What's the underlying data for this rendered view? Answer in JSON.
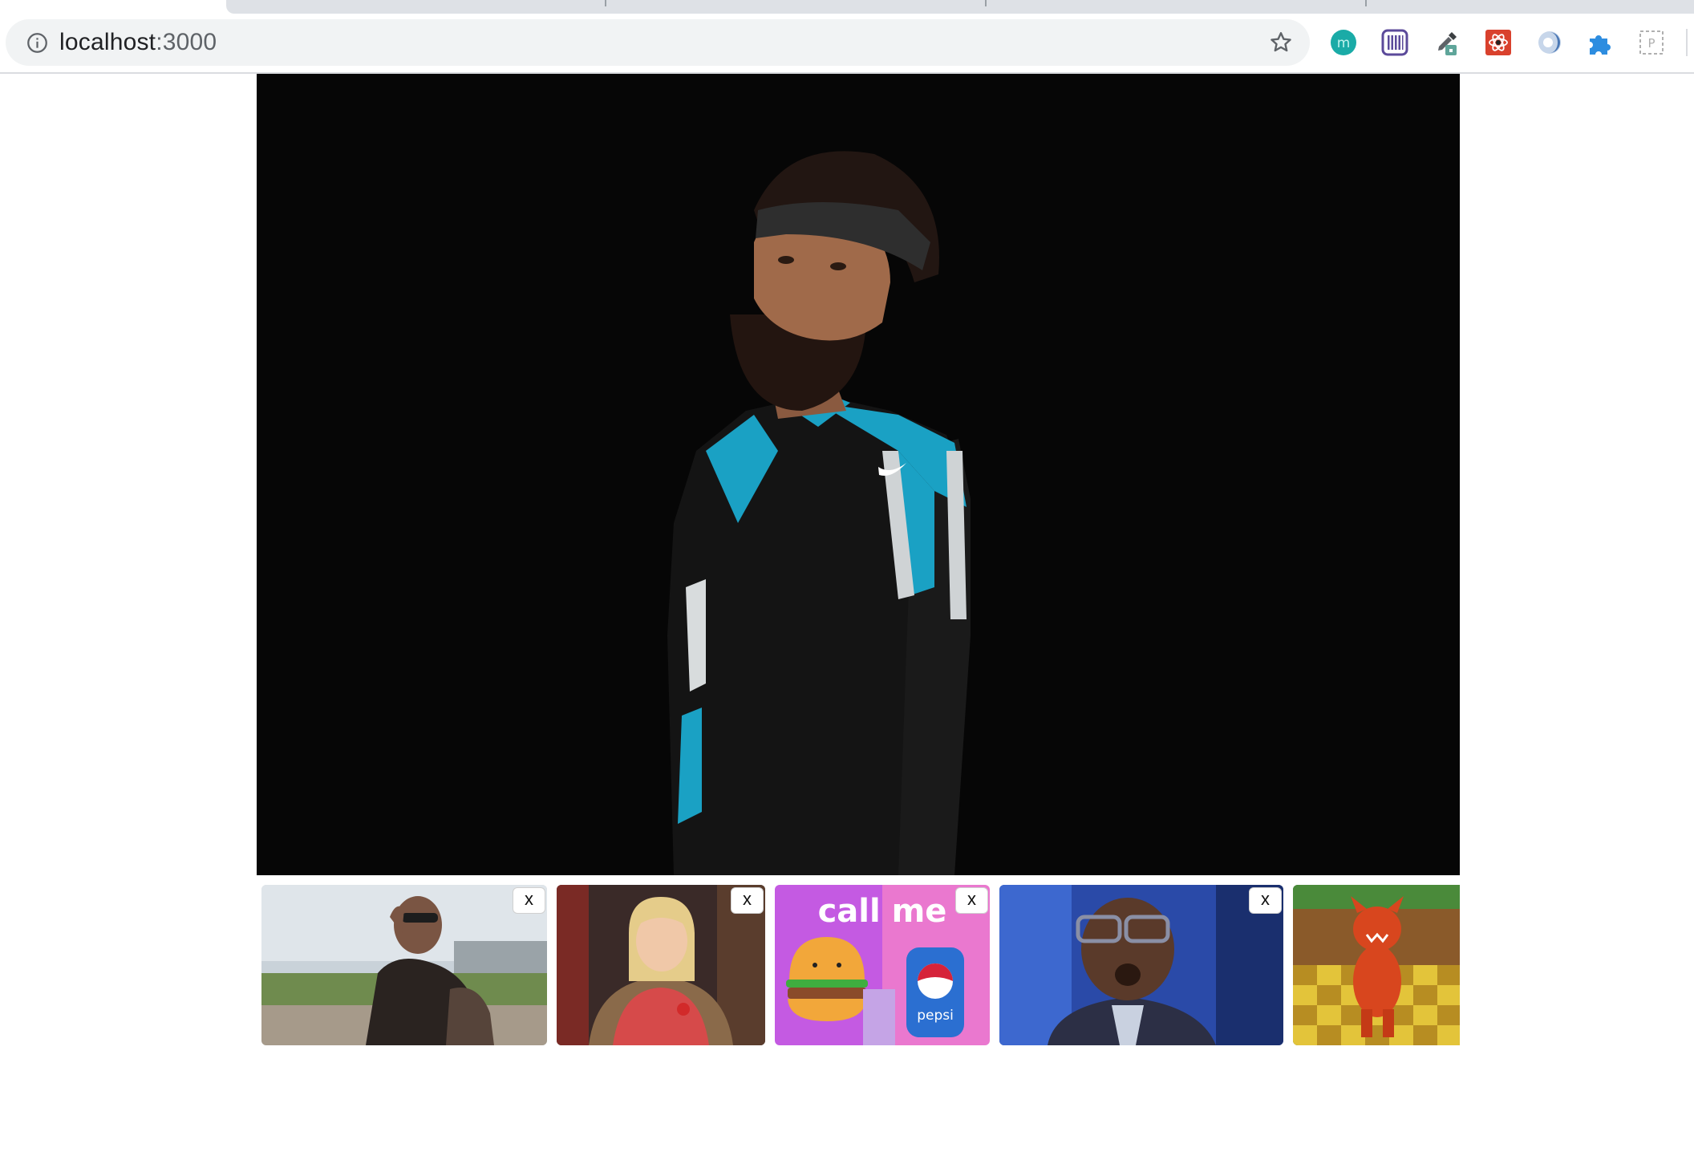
{
  "browser": {
    "url_host": "localhost",
    "url_port": ":3000",
    "extensions": [
      "teal-m-extension-icon",
      "purple-barcode-extension-icon",
      "eyedropper-extension-icon",
      "react-devtools-extension-icon",
      "blue-circle-extension-icon",
      "puzzle-extension-icon",
      "dashed-selection-extension-icon"
    ]
  },
  "main_gif": {
    "description_icon": "football-player-gif"
  },
  "thumbnails": [
    {
      "icon": "man-sunglasses-gif",
      "close_label": "x"
    },
    {
      "icon": "girl-smiling-gif",
      "close_label": "x"
    },
    {
      "icon": "call-me-burger-pepsi-gif",
      "caption": "call me",
      "can_text": "pepsi",
      "close_label": "x"
    },
    {
      "icon": "man-glasses-surprised-gif",
      "close_label": "x"
    },
    {
      "icon": "cartoon-dancing-creature-gif"
    }
  ],
  "colors": {
    "accent_teal": "#1aa1c4",
    "chrome_bg": "#f1f3f4"
  }
}
